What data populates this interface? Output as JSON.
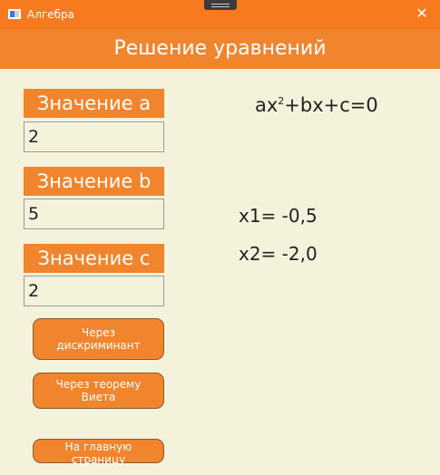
{
  "window": {
    "title": "Алгебра",
    "close": "✕"
  },
  "header": {
    "title": "Решение уравнений"
  },
  "inputs": {
    "a": {
      "label": "Значение a",
      "value": "2"
    },
    "b": {
      "label": "Значение b",
      "value": "5"
    },
    "c": {
      "label": "Значение c",
      "value": "2"
    }
  },
  "formula": {
    "p1": "ax",
    "exp": "2",
    "p2": "+bx+c=0"
  },
  "results": {
    "x1": "x1=  -0,5",
    "x2": "x2=  -2,0"
  },
  "buttons": {
    "discriminant": "Через дискриминант",
    "vieta": "Через теорему Виета",
    "home": "На главную страницу"
  },
  "colors": {
    "titlebar": "#f77b1e",
    "accent": "#f0852e",
    "background": "#f5f2dc"
  },
  "icons": {
    "app": "app-window-icon",
    "close": "close-icon"
  }
}
